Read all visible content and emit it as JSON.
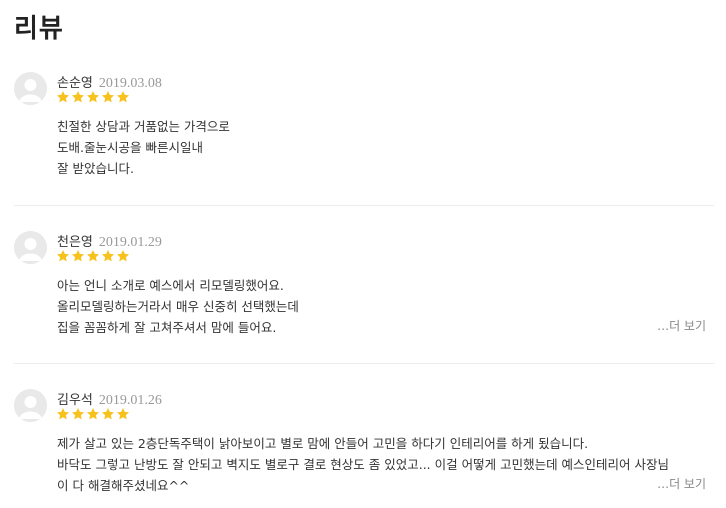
{
  "title": "리뷰",
  "reviews": [
    {
      "name": "손순영",
      "date": "2019.03.08",
      "stars": 5,
      "lines": [
        "친절한 상담과 거품없는 가격으로",
        "도배.줄눈시공을 빠른시일내",
        "잘 받았습니다."
      ],
      "more": ""
    },
    {
      "name": "천은영",
      "date": "2019.01.29",
      "stars": 5,
      "lines": [
        "아는 언니 소개로 예스에서 리모델링했어요.",
        "올리모델링하는거라서 매우 신중히 선택했는데",
        "집을 꼼꼼하게 잘 고쳐주셔서 맘에 들어요."
      ],
      "more": "…더 보기"
    },
    {
      "name": "김우석",
      "date": "2019.01.26",
      "stars": 5,
      "lines": [
        "제가 살고 있는 2층단독주택이 낡아보이고 별로 맘에 안들어 고민을 하다기 인테리어를 하게 됬습니다.",
        "바닥도 그렇고 난방도 잘 안되고 벽지도 별로구 결로 현상도 좀 있었고... 이걸 어떻게 고민했는데 예스인테리어 사장님",
        "이 다 해결해주셨네요^^"
      ],
      "more": "…더 보기"
    }
  ],
  "colors": {
    "star": "#f7c21b",
    "avatar_bg": "#e9e9e9",
    "avatar_fg": "#ffffff",
    "divider": "#ececec",
    "date": "#999999",
    "more": "#888888"
  },
  "icons": {
    "avatar": "user-silhouette-icon",
    "star": "star-icon"
  }
}
